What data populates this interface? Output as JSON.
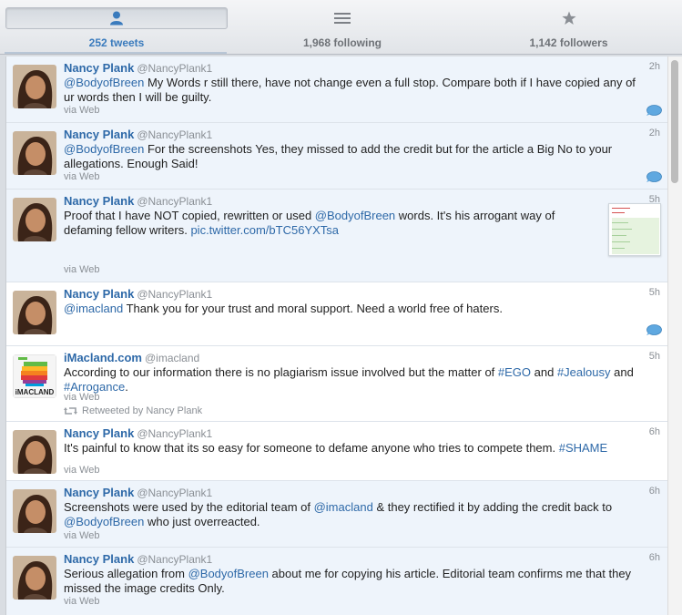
{
  "tabs": [
    {
      "label": "252 tweets",
      "icon": "person-icon",
      "selected": true
    },
    {
      "label": "1,968 following",
      "icon": "list-icon",
      "selected": false
    },
    {
      "label": "1,142 followers",
      "icon": "star-icon",
      "selected": false
    }
  ],
  "tweets": [
    {
      "name": "Nancy Plank",
      "handle": "@NancyPlank1",
      "time": "2h",
      "text": [
        {
          "t": "@BodyofBreen",
          "link": true
        },
        {
          "t": " My Words r still there, have not change even a full stop. Compare both if I have copied any of ur words then I will be guilty."
        }
      ],
      "via": "via Web",
      "conversation": true
    },
    {
      "name": "Nancy Plank",
      "handle": "@NancyPlank1",
      "time": "2h",
      "text": [
        {
          "t": "@BodyofBreen",
          "link": true
        },
        {
          "t": " For the screenshots Yes, they missed to add the credit but for the article a Big No to your allegations. Enough Said!"
        }
      ],
      "via": "via Web",
      "conversation": true
    },
    {
      "name": "Nancy Plank",
      "handle": "@NancyPlank1",
      "time": "5h",
      "text": [
        {
          "t": "Proof that I have NOT copied, rewritten or used "
        },
        {
          "t": "@BodyofBreen",
          "link": true
        },
        {
          "t": " words. It's his arrogant way of defaming fellow writers. "
        },
        {
          "t": "pic.twitter.com/bTC56YXTsa",
          "link": true
        }
      ],
      "via": "via Web",
      "has_image": true
    },
    {
      "name": "Nancy Plank",
      "handle": "@NancyPlank1",
      "time": "5h",
      "text": [
        {
          "t": "@imacland",
          "link": true
        },
        {
          "t": " Thank you for your trust and moral support. Need a world free of haters."
        }
      ],
      "via": "",
      "conversation": true
    },
    {
      "name": "iMacland.com",
      "handle": "@imacland",
      "time": "5h",
      "text": [
        {
          "t": "According to our information there is no plagiarism issue involved but the matter of "
        },
        {
          "t": "#EGO",
          "link": true
        },
        {
          "t": " and "
        },
        {
          "t": "#Jealousy",
          "link": true
        },
        {
          "t": " and "
        },
        {
          "t": "#Arrogance",
          "link": true
        },
        {
          "t": "."
        }
      ],
      "via": "via Web",
      "retweeted_by": "Retweeted by Nancy Plank",
      "avatar_text": "iMACLAND"
    },
    {
      "name": "Nancy Plank",
      "handle": "@NancyPlank1",
      "time": "6h",
      "text": [
        {
          "t": "It's painful to know that its so easy for someone to defame anyone who tries to compete them. "
        },
        {
          "t": "#SHAME",
          "link": true
        }
      ],
      "via": "via Web"
    },
    {
      "name": "Nancy Plank",
      "handle": "@NancyPlank1",
      "time": "6h",
      "text": [
        {
          "t": "Screenshots were used by the editorial team of "
        },
        {
          "t": "@imacland",
          "link": true
        },
        {
          "t": " & they rectified it by adding the credit back to "
        },
        {
          "t": "@BodyofBreen",
          "link": true
        },
        {
          "t": " who just overreacted."
        }
      ],
      "via": "via Web"
    },
    {
      "name": "Nancy Plank",
      "handle": "@NancyPlank1",
      "time": "6h",
      "text": [
        {
          "t": "Serious allegation from "
        },
        {
          "t": "@BodyofBreen",
          "link": true
        },
        {
          "t": " about me for copying his article. Editorial team confirms me that they missed the image credits Only."
        }
      ],
      "via": "via Web"
    }
  ],
  "colors": {
    "link": "#2e69a8",
    "selected_tab": "#3a7bbd",
    "muted": "#8a8f95",
    "row_blue": "#eef4fb",
    "bubble": "#5fa8e0"
  }
}
